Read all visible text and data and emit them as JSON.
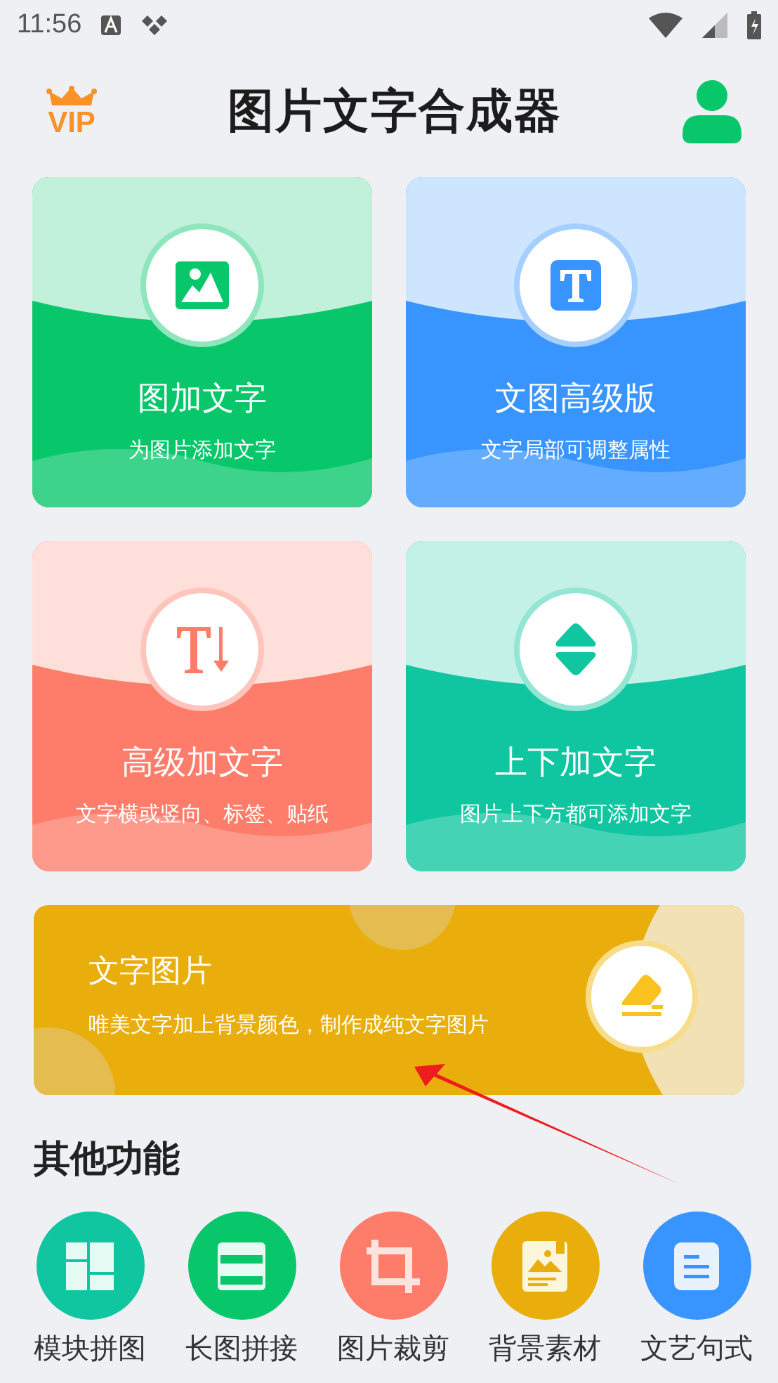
{
  "status_bar": {
    "time": "11:56"
  },
  "header": {
    "vip_label": "VIP",
    "title": "图片文字合成器"
  },
  "cards": [
    {
      "title": "图加文字",
      "subtitle": "为图片添加文字",
      "kind": "image",
      "color": "#08c76a"
    },
    {
      "title": "文图高级版",
      "subtitle": "文字局部可调整属性",
      "kind": "text",
      "color": "#3895ff"
    },
    {
      "title": "高级加文字",
      "subtitle": "文字横或竖向、标签、贴纸",
      "kind": "vertical",
      "color": "#fe7d6a"
    },
    {
      "title": "上下加文字",
      "subtitle": "图片上下方都可添加文字",
      "kind": "updown",
      "color": "#10c6a0"
    }
  ],
  "banner": {
    "title": "文字图片",
    "subtitle": "唯美文字加上背景颜色，制作成纯文字图片"
  },
  "section_title": "其他功能",
  "tools": [
    {
      "label": "模块拼图",
      "kind": "grid",
      "color": "#10c6a0"
    },
    {
      "label": "长图拼接",
      "kind": "stack",
      "color": "#08c76a"
    },
    {
      "label": "图片裁剪",
      "kind": "crop",
      "color": "#fe7d6a"
    },
    {
      "label": "背景素材",
      "kind": "picture",
      "color": "#e9ae0b"
    },
    {
      "label": "文艺句式",
      "kind": "doc",
      "color": "#3895ff"
    }
  ]
}
